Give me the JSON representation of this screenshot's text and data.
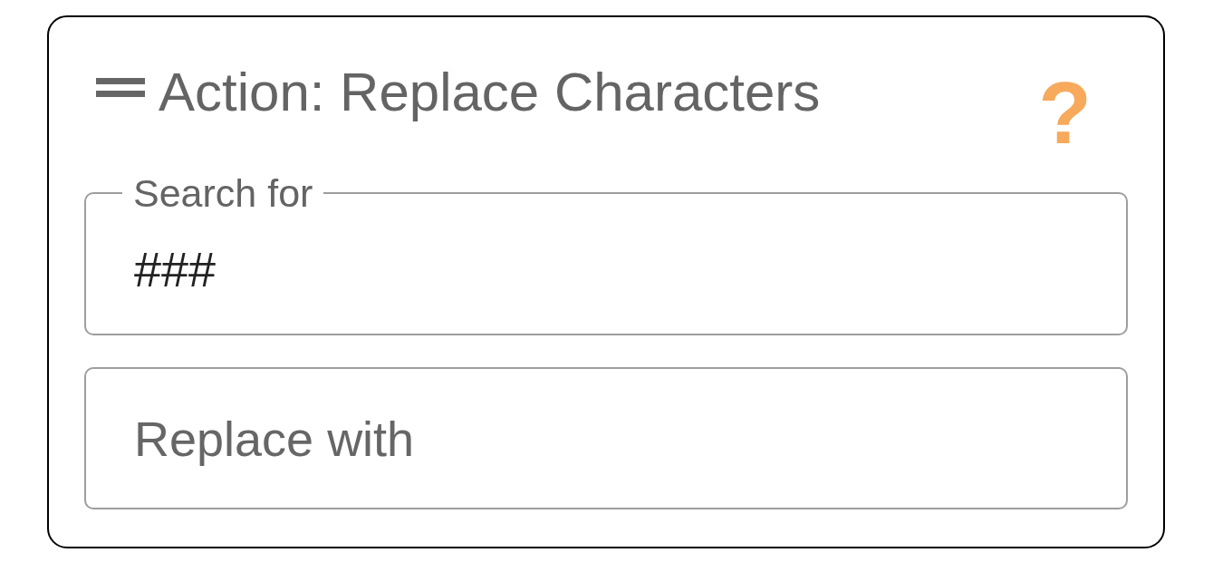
{
  "card": {
    "title": "Action: Replace Characters",
    "help_icon": "?"
  },
  "fields": [
    {
      "label": "Search for",
      "value": "###"
    },
    {
      "placeholder": "Replace with"
    }
  ]
}
